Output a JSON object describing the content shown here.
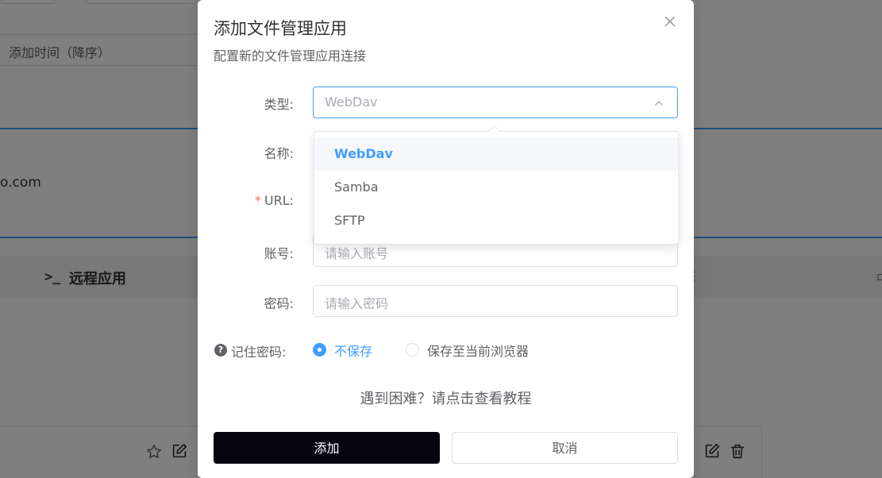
{
  "background": {
    "sort_select": "添加时间（降序）",
    "card_text": "o.com",
    "section_icon": ">_",
    "section_title": "远程应用"
  },
  "dialog": {
    "title": "添加文件管理应用",
    "subtitle": "配置新的文件管理应用连接",
    "form": {
      "type_label": "类型:",
      "type_value": "WebDav",
      "name_label": "名称:",
      "url_required_mark": "*",
      "url_label": "URL:",
      "account_label": "账号:",
      "account_placeholder": "请输入账号",
      "password_label": "密码:",
      "password_placeholder": "请输入密码",
      "remember_help_icon": "?",
      "remember_label": "记住密码:",
      "remember_options": [
        {
          "label": "不保存",
          "checked": true
        },
        {
          "label": "保存至当前浏览器",
          "checked": false
        }
      ]
    },
    "help_link": "遇到困难？请点击查看教程",
    "buttons": {
      "add": "添加",
      "cancel": "取消"
    }
  },
  "dropdown": {
    "options": [
      {
        "label": "WebDav",
        "selected": true
      },
      {
        "label": "Samba",
        "selected": false
      },
      {
        "label": "SFTP",
        "selected": false
      }
    ]
  },
  "colors": {
    "accent": "#409eff",
    "primary_button": "#05040f",
    "required": "#f56c6c",
    "overlay": "rgba(0,0,0,0.5)"
  },
  "icons": {
    "close": "close-icon",
    "select_arrow": "chevron-up-icon",
    "star": "star-icon",
    "edit": "edit-icon",
    "delete": "trash-icon"
  }
}
